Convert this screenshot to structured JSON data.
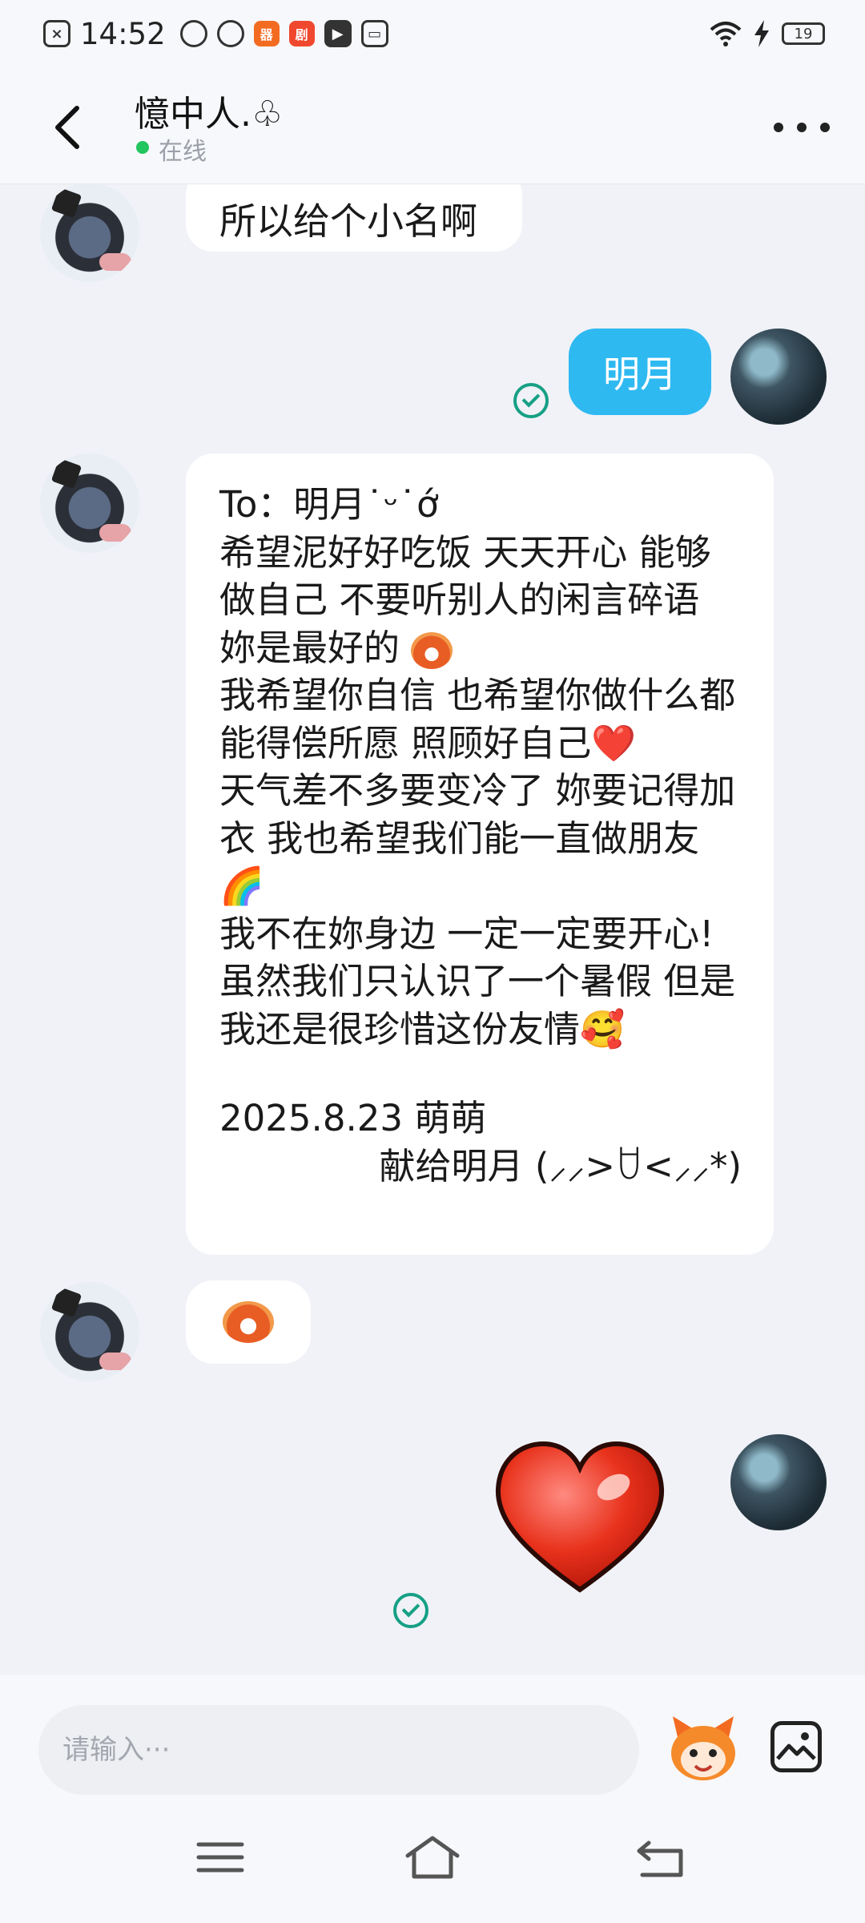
{
  "status_bar": {
    "time": "14:52",
    "battery": "19",
    "app_icons": [
      "x-box-icon",
      "cloud-drive-icon",
      "cloud-drive-icon",
      "orange-app-icon",
      "orange-app-icon",
      "video-play-icon",
      "wallet-icon"
    ]
  },
  "header": {
    "contact_name": "憶中人.♧",
    "online_status": "在线"
  },
  "messages": {
    "m1_text": "所以给个小名啊",
    "m2_text": "明月",
    "letter": {
      "line_to": "To：明月˙ᵕ˙ớ",
      "body_1": "希望泥好好吃饭 天天开心 能够做自己 不要听别人的闲言碎语 妳是最好的",
      "body_2": "我希望你自信 也希望你做什么都能得偿所愿 照顾好自己❤️",
      "body_3": "天气差不多要变冷了 妳要记得加衣 我也希望我们能一直做朋友🌈",
      "body_4": "我不在妳身边 一定一定要开心!",
      "body_5": "虽然我们只认识了一个暑假 但是我还是很珍惜这份友情🥰",
      "date_line": "2025.8.23 萌萌",
      "sign_line": "献给明月 (⸝⸝>ꇴ<⸝⸝*)"
    }
  },
  "input": {
    "placeholder": "请输入···"
  },
  "colors": {
    "accent_blue": "#2fb9f1",
    "read_green": "#16a085",
    "online_green": "#22c55e",
    "background": "#f0f2f7"
  }
}
